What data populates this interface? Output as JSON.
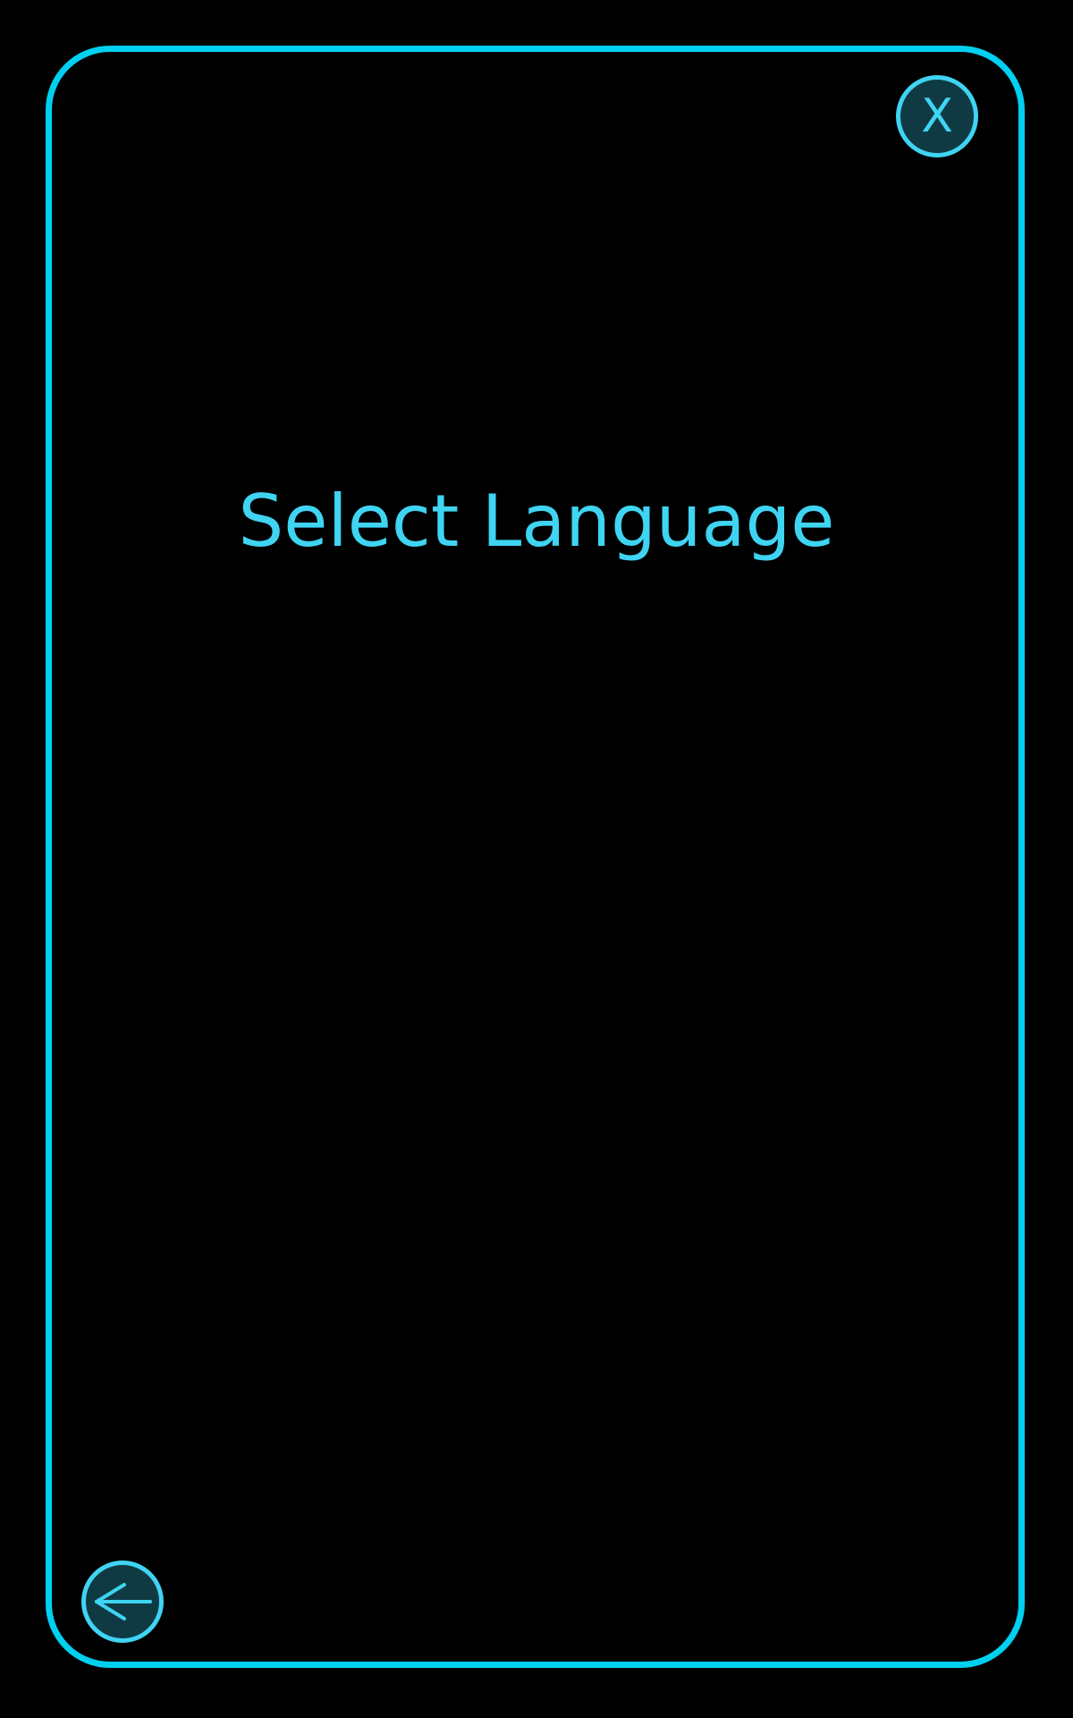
{
  "screen": {
    "title": "Select Language"
  },
  "buttons": {
    "close_label": "X",
    "back_icon": "arrow-left-icon"
  },
  "colors": {
    "background": "#000000",
    "frame_border": "#00d0f0",
    "accent": "#3fd4f2",
    "button_fill": "#0f3a44"
  }
}
